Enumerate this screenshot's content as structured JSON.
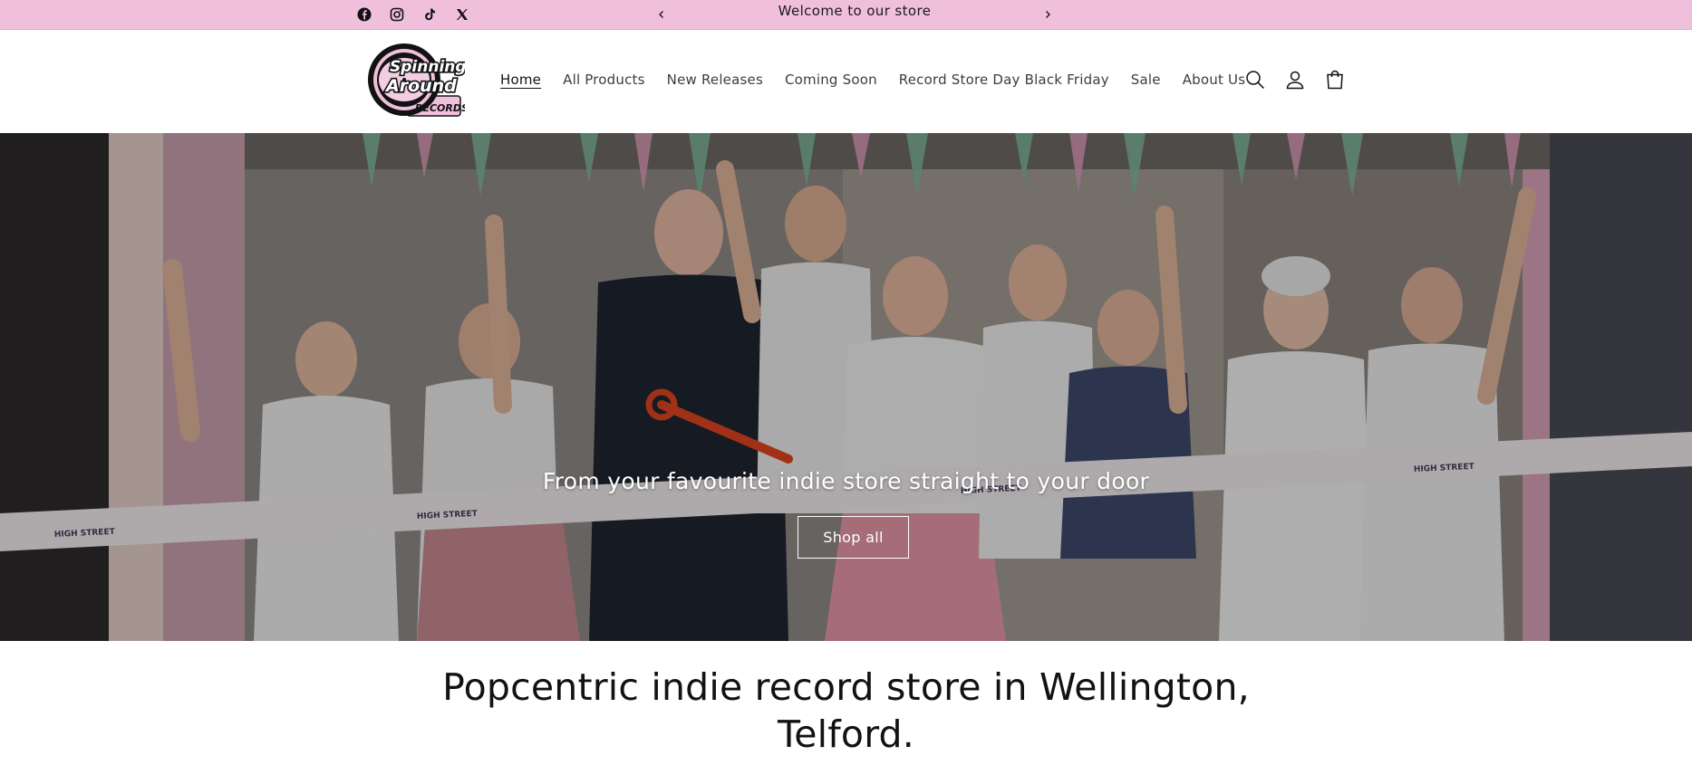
{
  "announcement": {
    "text": "Welcome to our store",
    "prev_icon": "chevron-left-icon",
    "next_icon": "chevron-right-icon",
    "background": "#f0bfdc"
  },
  "social": [
    "facebook-icon",
    "instagram-icon",
    "tiktok-icon",
    "x-icon"
  ],
  "logo": {
    "line1": "Spinning",
    "line2": "Around",
    "line3": "RECORDS"
  },
  "nav": {
    "items": [
      {
        "label": "Home",
        "active": true
      },
      {
        "label": "All Products"
      },
      {
        "label": "New Releases"
      },
      {
        "label": "Coming Soon"
      },
      {
        "label": "Record Store Day Black Friday"
      },
      {
        "label": "Sale"
      },
      {
        "label": "About Us"
      }
    ]
  },
  "header_icons": [
    "search-icon",
    "account-icon",
    "cart-icon"
  ],
  "hero": {
    "caption": "From your favourite indie store straight to your door",
    "button_label": "Shop all",
    "ribbon_text": "HIGH STREET"
  },
  "intro": {
    "heading": "Popcentric indie record store in Wellington, Telford."
  }
}
